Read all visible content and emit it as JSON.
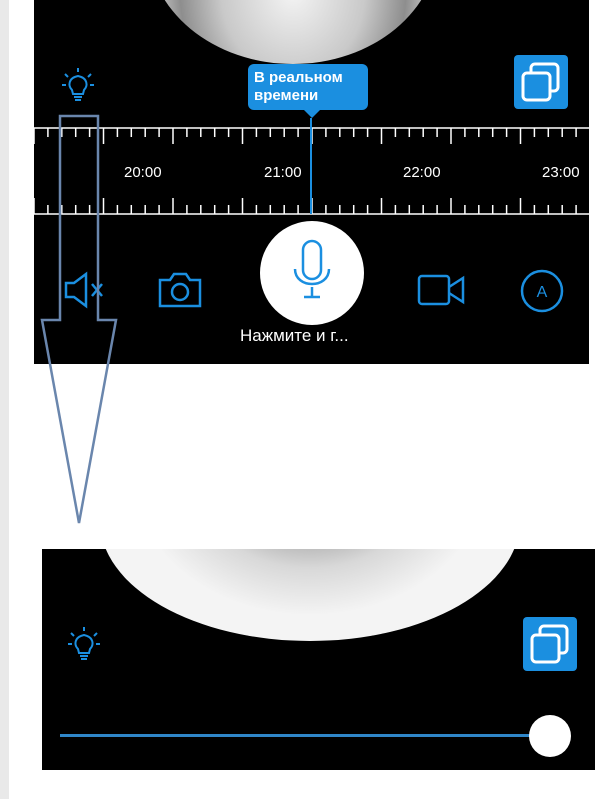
{
  "top_view": {
    "live_badge": {
      "line1": "В реальном",
      "line2": "времени"
    },
    "timeline": {
      "labels": [
        "20:00",
        "21:00",
        "22:00",
        "23:00"
      ]
    },
    "controls": {
      "mic_caption": "Нажмите и г..."
    },
    "icons": [
      "light-bulb-icon",
      "switch-view-icon",
      "speaker-mute-icon",
      "camera-icon",
      "microphone-icon",
      "video-record-icon",
      "auto-mode-icon"
    ]
  },
  "bottom_view": {
    "slider": {
      "value_fraction": 1.0
    },
    "icons": [
      "light-bulb-icon",
      "switch-view-icon"
    ]
  },
  "colors": {
    "accent": "#1b8fe0",
    "background": "#000000"
  }
}
